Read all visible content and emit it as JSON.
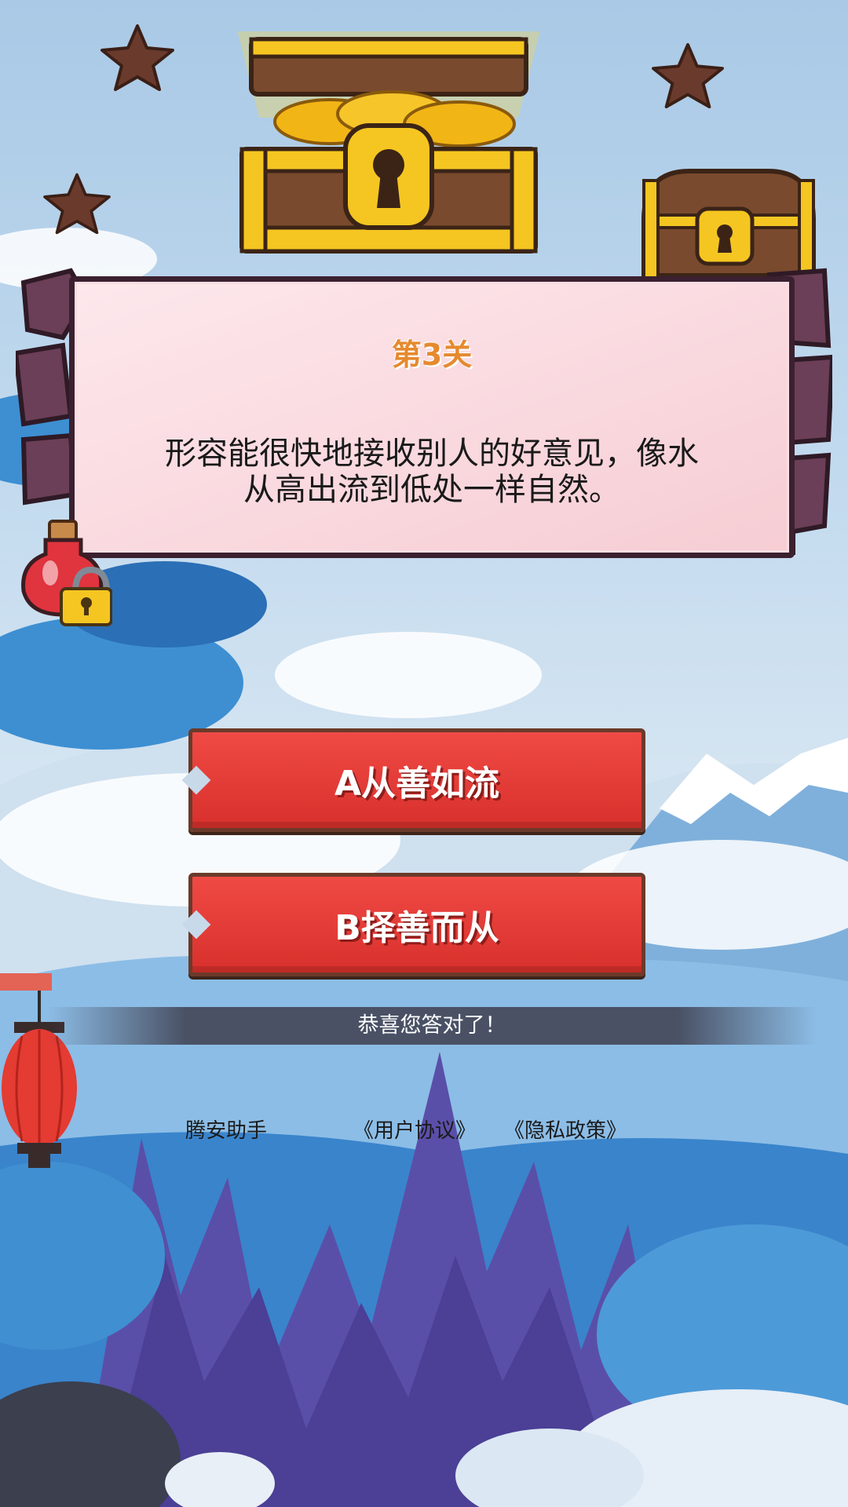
{
  "level": {
    "title": "第3关"
  },
  "question": {
    "line1": "形容能很快地接收别人的好意见，像水",
    "line2": "从高出流到低处一样自然。"
  },
  "answers": [
    {
      "label": "A从善如流"
    },
    {
      "label": "B择善而从"
    }
  ],
  "result": {
    "message": "恭喜您答对了！"
  },
  "footer": {
    "brand": "腾安助手",
    "agreement": "《用户协议》",
    "privacy": "《隐私政策》"
  },
  "colors": {
    "button_red": "#e23c37",
    "title_orange": "#e58a2f",
    "board_pink": "#f9d6dc"
  }
}
